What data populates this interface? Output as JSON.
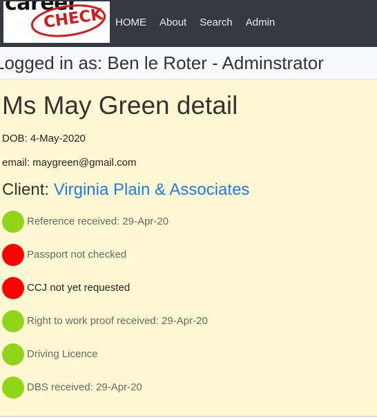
{
  "nav": {
    "logo": {
      "career_text": "career",
      "check_text": "CHECK"
    },
    "links": [
      "HOME",
      "About",
      "Search",
      "Admin"
    ]
  },
  "login": {
    "text": "Logged in as: Ben le Roter - Adminstrator"
  },
  "candidate": {
    "title": "Ms May Green detail",
    "dob": "DOB: 4-May-2020",
    "email": "email: maygreen@gmail.com",
    "client_prefix": "Client: ",
    "client_name": "Virginia Plain & Associates"
  },
  "checks": [
    {
      "label": "Reference received: 29-Apr-20",
      "status": "green",
      "text_color": "#666666"
    },
    {
      "label": "Passport not checked",
      "status": "red",
      "text_color": "#666666"
    },
    {
      "label": "CCJ not yet requested",
      "status": "red",
      "text_color": "#222222"
    },
    {
      "label": "Right to work proof received: 29-Apr-20",
      "status": "green",
      "text_color": "#666666"
    },
    {
      "label": "Driving Licence",
      "status": "green",
      "text_color": "#666666"
    },
    {
      "label": "DBS received: 29-Apr-20",
      "status": "green",
      "text_color": "#666666"
    }
  ],
  "colors": {
    "navbar": "#343a40",
    "main_bg": "#fff8d2",
    "status_green": "#8fd619",
    "status_red": "#ff0000",
    "link": "#1b7ce8",
    "logo_red": "#d11a1a"
  }
}
